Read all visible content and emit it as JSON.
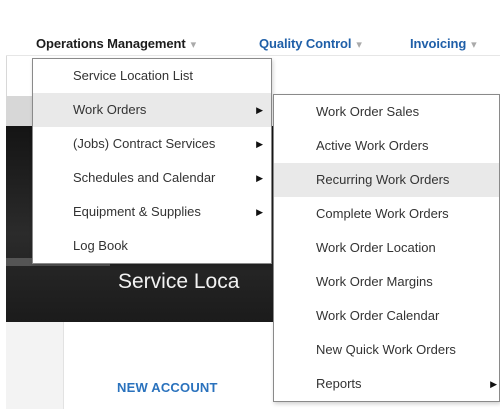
{
  "nav": {
    "items": [
      {
        "label": "Operations Management",
        "caret": "▾"
      },
      {
        "label": "Quality Control",
        "caret": "▾"
      },
      {
        "label": "Invoicing",
        "caret": "▾"
      }
    ]
  },
  "operations_menu": {
    "items": [
      {
        "label": "Service Location List"
      },
      {
        "label": "Work Orders",
        "arrow": "▶"
      },
      {
        "label": "(Jobs) Contract Services",
        "arrow": "▶"
      },
      {
        "label": "Schedules and Calendar",
        "arrow": "▶"
      },
      {
        "label": "Equipment & Supplies",
        "arrow": "▶"
      },
      {
        "label": "Log Book"
      }
    ],
    "highlighted": "Work Orders"
  },
  "work_orders_submenu": {
    "items": [
      {
        "label": "Work Order Sales"
      },
      {
        "label": "Active Work Orders"
      },
      {
        "label": "Recurring Work Orders"
      },
      {
        "label": "Complete Work Orders"
      },
      {
        "label": "Work Order Location"
      },
      {
        "label": "Work Order Margins"
      },
      {
        "label": "Work Order Calendar"
      },
      {
        "label": "New Quick Work Orders"
      },
      {
        "label": "Reports",
        "arrow": "▶"
      }
    ],
    "highlighted": "Recurring Work Orders"
  },
  "hero": {
    "title": "Service Loca"
  },
  "content": {
    "new_account_label": "NEW ACCOUNT"
  },
  "colors": {
    "nav_link": "#1f5fa8",
    "nav_active": "#1c1c1c",
    "menu_highlight": "#e9e9e9",
    "accent_link": "#2a72bd",
    "hero_background": "#1b1b1b"
  }
}
